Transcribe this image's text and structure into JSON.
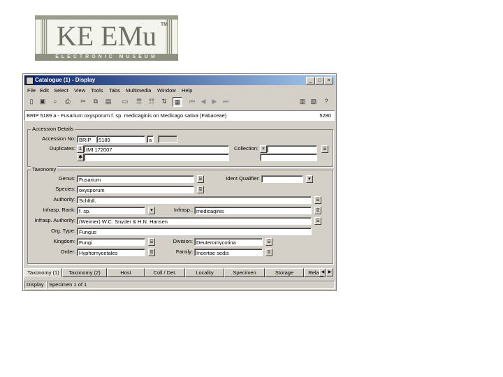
{
  "logo": {
    "name": "KE EMu",
    "tm": "TM",
    "tagline": "ELECTRONIC MUSEUM"
  },
  "window": {
    "title": "Catalogue (1) - Display",
    "controls": {
      "minimize": "_",
      "maximize": "□",
      "close": "×"
    }
  },
  "menu": [
    "File",
    "Edit",
    "Select",
    "View",
    "Tools",
    "Tabs",
    "Multimedia",
    "Window",
    "Help"
  ],
  "record": {
    "title": "BRIP 5189 a - Fusarium oxysporum f. sp. medicaginis on Medicago sativa (Fabaceae)",
    "count": "5280"
  },
  "accession": {
    "group_label": "Accession Details",
    "accession_no_label": "Accession No:",
    "accession_prefix": "BRIP",
    "accession_number": "5189",
    "accession_suffix": "a",
    "duplicates_label": "Duplicates:",
    "duplicate_index": "1",
    "duplicate_value": "IMI 172007",
    "duplicate_new_marker": "✱",
    "collection_label": "Collection:",
    "collection_marker": "×"
  },
  "taxonomy": {
    "group_label": "Taxonomy",
    "genus_label": "Genus:",
    "genus": "Fusarium",
    "ident_qualifier_label": "Ident Qualifier:",
    "ident_qualifier": "",
    "species_label": "Species:",
    "species": "oxysporum",
    "authority_label": "Authority:",
    "authority": "Schltdl.",
    "infrasp_rank_label": "Infrasp. Rank:",
    "infrasp_rank": "f. sp.",
    "infrasp_label": "Infrasp.:",
    "infrasp": "medicaginis",
    "infrasp_authority_label": "Infrasp. Authority:",
    "infrasp_authority": "(Weimer) W.C. Snyder & H.N. Hansen",
    "org_type_label": "Org. Type:",
    "org_type": "Fungus",
    "kingdom_label": "Kingdom:",
    "kingdom": "Fungi",
    "division_label": "Division:",
    "division": "Deuteromycotina",
    "order_label": "Order:",
    "order": "Hyphomycetales",
    "family_label": "Family:",
    "family": "Incertae sedis"
  },
  "tabs": [
    "Taxonomy (1)",
    "Taxonomy (2)",
    "Host",
    "Coll / Det.",
    "Locality",
    "Specimen",
    "Storage",
    "Rela"
  ],
  "status": {
    "mode": "Display",
    "message": "Specimen 1 of 1"
  }
}
